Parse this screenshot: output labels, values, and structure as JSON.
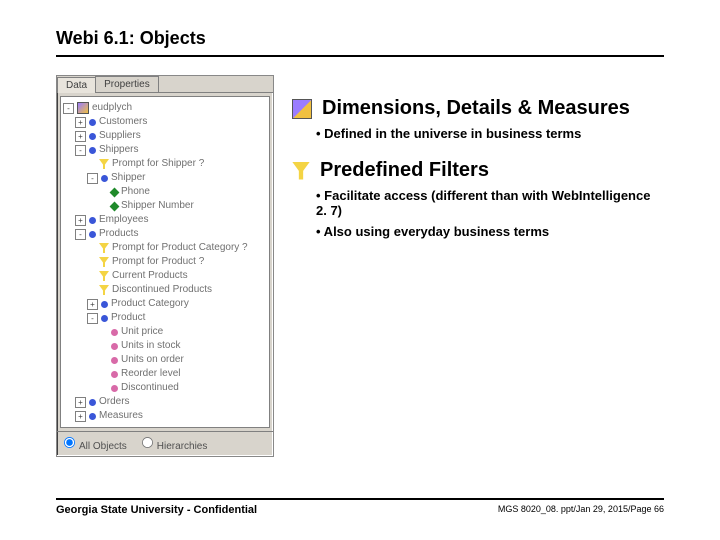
{
  "title": "Webi 6.1: Objects",
  "tree": {
    "tabs": [
      "Data",
      "Properties"
    ],
    "root": "eudplych",
    "nodes": [
      {
        "level": 0,
        "toggle": "-",
        "icon": "cube",
        "label": "eudplych"
      },
      {
        "level": 1,
        "toggle": "+",
        "icon": "dim",
        "label": "Customers"
      },
      {
        "level": 1,
        "toggle": "+",
        "icon": "dim",
        "label": "Suppliers"
      },
      {
        "level": 1,
        "toggle": "-",
        "icon": "dim",
        "label": "Shippers"
      },
      {
        "level": 2,
        "toggle": " ",
        "icon": "filter",
        "label": "Prompt for Shipper ?"
      },
      {
        "level": 2,
        "toggle": "-",
        "icon": "dim",
        "label": "Shipper"
      },
      {
        "level": 3,
        "toggle": " ",
        "icon": "detail",
        "label": "Phone"
      },
      {
        "level": 3,
        "toggle": " ",
        "icon": "detail",
        "label": "Shipper Number"
      },
      {
        "level": 1,
        "toggle": "+",
        "icon": "dim",
        "label": "Employees"
      },
      {
        "level": 1,
        "toggle": "-",
        "icon": "dim",
        "label": "Products"
      },
      {
        "level": 2,
        "toggle": " ",
        "icon": "filter",
        "label": "Prompt for Product Category ?"
      },
      {
        "level": 2,
        "toggle": " ",
        "icon": "filter",
        "label": "Prompt for Product ?"
      },
      {
        "level": 2,
        "toggle": " ",
        "icon": "filter",
        "label": "Current Products"
      },
      {
        "level": 2,
        "toggle": " ",
        "icon": "filter",
        "label": "Discontinued Products"
      },
      {
        "level": 2,
        "toggle": "+",
        "icon": "dim",
        "label": "Product Category"
      },
      {
        "level": 2,
        "toggle": "-",
        "icon": "dim",
        "label": "Product"
      },
      {
        "level": 3,
        "toggle": " ",
        "icon": "measure",
        "label": "Unit price"
      },
      {
        "level": 3,
        "toggle": " ",
        "icon": "measure",
        "label": "Units in stock"
      },
      {
        "level": 3,
        "toggle": " ",
        "icon": "measure",
        "label": "Units on order"
      },
      {
        "level": 3,
        "toggle": " ",
        "icon": "measure",
        "label": "Reorder level"
      },
      {
        "level": 3,
        "toggle": " ",
        "icon": "measure",
        "label": "Discontinued"
      },
      {
        "level": 1,
        "toggle": "+",
        "icon": "dim",
        "label": "Orders"
      },
      {
        "level": 1,
        "toggle": "+",
        "icon": "dim",
        "label": "Measures"
      }
    ],
    "radios": [
      "All Objects",
      "Hierarchies"
    ]
  },
  "sections": [
    {
      "icon": "cube",
      "heading": "Dimensions, Details & Measures",
      "bullets": [
        "• Defined in the universe in business terms"
      ]
    },
    {
      "icon": "filter",
      "heading": "Predefined Filters",
      "bullets": [
        "• Facilitate access (different than with WebIntelligence 2. 7)",
        "• Also using everyday business terms"
      ]
    }
  ],
  "footer": {
    "left": "Georgia State University - Confidential",
    "right": "MGS 8020_08. ppt/Jan 29, 2015/Page 66"
  }
}
